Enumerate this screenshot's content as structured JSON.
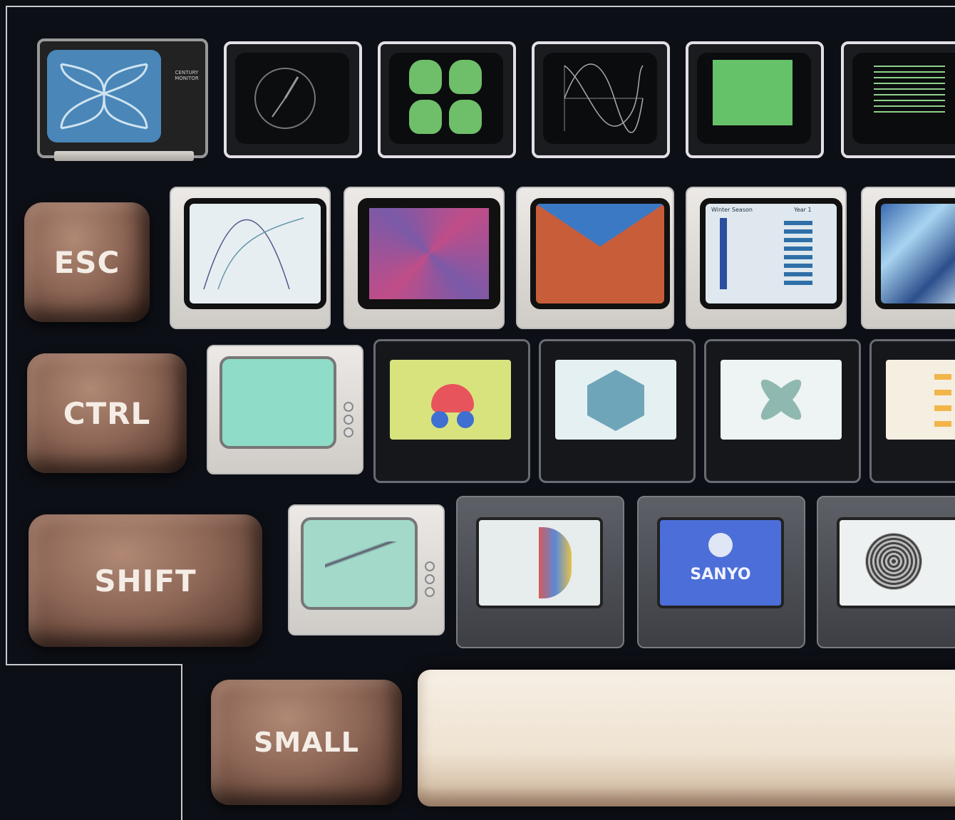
{
  "keys": {
    "esc": "ESC",
    "ctrl": "CTRL",
    "shift": "SHIFT",
    "small": "SMALL"
  },
  "screens": {
    "sanyo_logo": "SANYO",
    "winter_season": "Winter Season",
    "year": "Year 1",
    "monitor_brand": "CENTURY MONITOR"
  }
}
